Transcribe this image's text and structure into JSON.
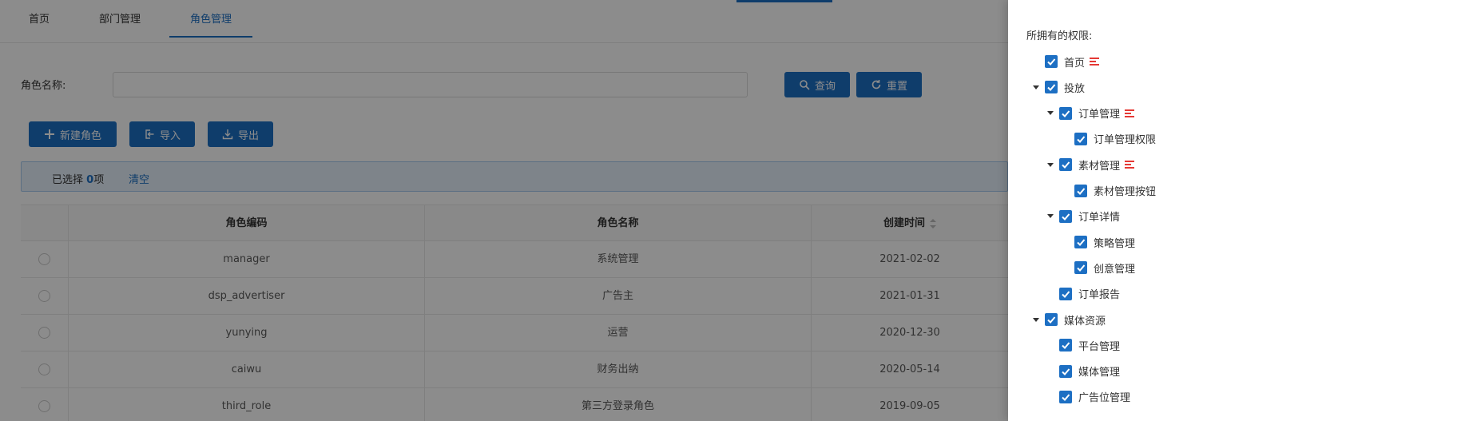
{
  "tabs": [
    "首页",
    "部门管理",
    "角色管理"
  ],
  "active_tab": "角色管理",
  "search": {
    "label": "角色名称:",
    "value": "",
    "placeholder": ""
  },
  "buttons": {
    "query": "查询",
    "reset": "重置",
    "new_role": "新建角色",
    "import": "导入",
    "export": "导出"
  },
  "selection": {
    "prefix": "已选择",
    "count": "0",
    "suffix": "项",
    "clear": "清空"
  },
  "table": {
    "headers": [
      "角色编码",
      "角色名称",
      "创建时间"
    ],
    "rows": [
      [
        "manager",
        "系统管理",
        "2021-02-02"
      ],
      [
        "dsp_advertiser",
        "广告主",
        "2021-01-31"
      ],
      [
        "yunying",
        "运营",
        "2020-12-30"
      ],
      [
        "caiwu",
        "财务出纳",
        "2020-05-14"
      ],
      [
        "third_role",
        "第三方登录角色",
        "2019-09-05"
      ]
    ]
  },
  "drawer": {
    "title": "所拥有的权限:",
    "tree": [
      {
        "label": "首页",
        "level": 0,
        "expander": false,
        "checked": true,
        "menu_icon": true
      },
      {
        "label": "投放",
        "level": 0,
        "expander": true,
        "checked": true,
        "menu_icon": false
      },
      {
        "label": "订单管理",
        "level": 1,
        "expander": true,
        "checked": true,
        "menu_icon": true
      },
      {
        "label": "订单管理权限",
        "level": 2,
        "expander": false,
        "checked": true,
        "menu_icon": false
      },
      {
        "label": "素材管理",
        "level": 1,
        "expander": true,
        "checked": true,
        "menu_icon": true
      },
      {
        "label": "素材管理按钮",
        "level": 2,
        "expander": false,
        "checked": true,
        "menu_icon": false
      },
      {
        "label": "订单详情",
        "level": 1,
        "expander": true,
        "checked": true,
        "menu_icon": false
      },
      {
        "label": "策略管理",
        "level": 2,
        "expander": false,
        "checked": true,
        "menu_icon": false
      },
      {
        "label": "创意管理",
        "level": 2,
        "expander": false,
        "checked": true,
        "menu_icon": false
      },
      {
        "label": "订单报告",
        "level": 1,
        "expander": false,
        "checked": true,
        "menu_icon": false
      },
      {
        "label": "媒体资源",
        "level": 0,
        "expander": true,
        "checked": true,
        "menu_icon": false
      },
      {
        "label": "平台管理",
        "level": 1,
        "expander": false,
        "checked": true,
        "menu_icon": false
      },
      {
        "label": "媒体管理",
        "level": 1,
        "expander": false,
        "checked": true,
        "menu_icon": false
      },
      {
        "label": "广告位管理",
        "level": 1,
        "expander": false,
        "checked": true,
        "menu_icon": false
      }
    ]
  },
  "colors": {
    "primary": "#1d6fc3",
    "menu_icon": "#e53935",
    "mask": "rgba(0,0,0,0.45)"
  },
  "icons": {
    "query": "search-icon",
    "reset": "refresh-icon",
    "new_role": "plus-icon",
    "import": "import-icon",
    "export": "download-icon"
  }
}
